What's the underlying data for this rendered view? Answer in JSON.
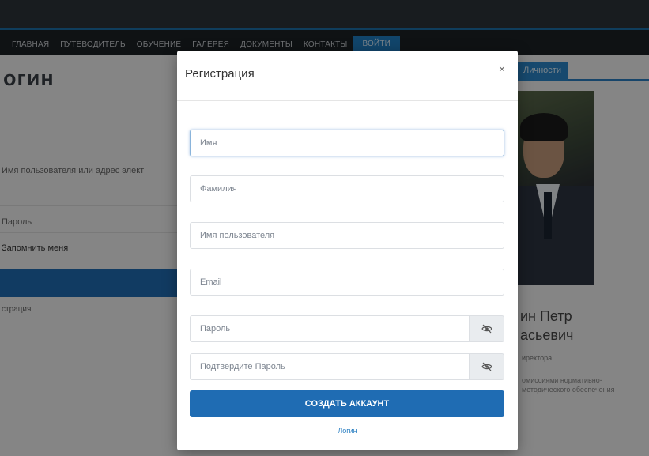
{
  "nav": {
    "items": [
      "главная",
      "путеводитель",
      "обучение",
      "галерея",
      "документы",
      "контакты",
      "войти"
    ]
  },
  "background": {
    "page_title": "огин",
    "username_label": "Имя пользователя или адрес элект",
    "password_label": "Пароль",
    "remember_label": "Запомнить меня",
    "register_link": "страция",
    "profile_tab": "Личности",
    "profile_name_line1": "ин Петр",
    "profile_name_line2": "асьевич",
    "profile_role": "иректора",
    "profile_desc": "омиссиями нормативно-методического обеспечения"
  },
  "modal": {
    "title": "Регистрация",
    "close_icon": "×",
    "first_name_placeholder": "Имя",
    "last_name_placeholder": "Фамилия",
    "username_placeholder": "Имя пользователя",
    "email_placeholder": "Email",
    "password_placeholder": "Пароль",
    "confirm_password_placeholder": "Подтвердите Пароль",
    "submit_label": "создать аккаунт",
    "login_link": "Логин"
  },
  "colors": {
    "primary": "#1f6cb3",
    "nav_active": "#1f7fc4",
    "navbar": "#1c2126"
  },
  "icons": {
    "password_toggle": "eye-slash-icon",
    "confirm_password_toggle": "eye-slash-icon"
  }
}
